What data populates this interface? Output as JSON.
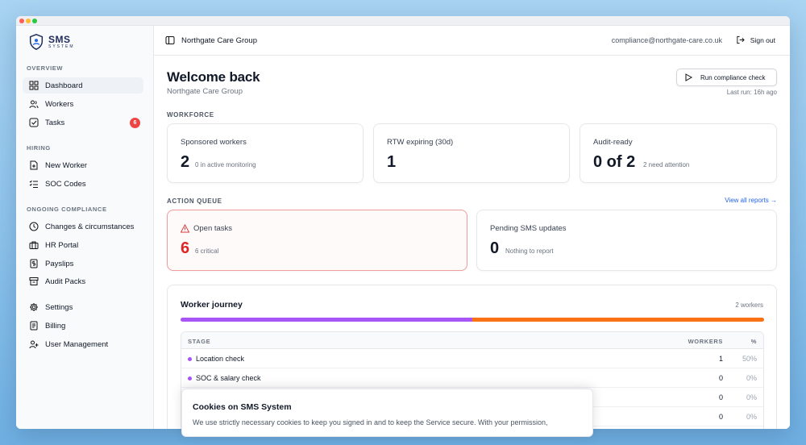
{
  "app": {
    "logo_main": "SMS",
    "logo_sub": "SYSTEM"
  },
  "sidebar": {
    "sections": [
      "OVERVIEW",
      "HIRING",
      "ONGOING COMPLIANCE"
    ],
    "items": [
      {
        "label": "Dashboard",
        "icon": "dashboard-icon",
        "active": true
      },
      {
        "label": "Workers",
        "icon": "users-icon"
      },
      {
        "label": "Tasks",
        "icon": "checkbox-icon",
        "badge": "6"
      },
      {
        "label": "New Worker",
        "icon": "file-plus-icon"
      },
      {
        "label": "SOC Codes",
        "icon": "list-check-icon"
      },
      {
        "label": "Changes & circumstances",
        "icon": "clock-icon"
      },
      {
        "label": "HR Portal",
        "icon": "briefcase-icon"
      },
      {
        "label": "Payslips",
        "icon": "receipt-icon"
      },
      {
        "label": "Audit Packs",
        "icon": "archive-icon"
      },
      {
        "label": "Settings",
        "icon": "gear-icon"
      },
      {
        "label": "Billing",
        "icon": "invoice-icon"
      },
      {
        "label": "User Management",
        "icon": "user-management-icon"
      }
    ]
  },
  "topbar": {
    "org": "Northgate Care Group",
    "email": "compliance@northgate-care.co.uk",
    "signout": "Sign out"
  },
  "header": {
    "title": "Welcome back",
    "subtitle": "Northgate Care Group",
    "run_button": "Run compliance check",
    "last_run": "Last run: 16h ago"
  },
  "workforce": {
    "label": "WORKFORCE",
    "cards": [
      {
        "title": "Sponsored workers",
        "value": "2",
        "note": "0 in active monitoring"
      },
      {
        "title": "RTW expiring (30d)",
        "value": "1",
        "note": ""
      },
      {
        "title": "Audit-ready",
        "value": "0 of 2",
        "note": "2 need attention"
      }
    ]
  },
  "action_queue": {
    "label": "ACTION QUEUE",
    "view_all": "View all reports →",
    "cards": [
      {
        "title": "Open tasks",
        "value": "6",
        "note": "6 critical"
      },
      {
        "title": "Pending SMS updates",
        "value": "0",
        "note": "Nothing to report"
      }
    ]
  },
  "journey": {
    "title": "Worker journey",
    "count": "2 workers",
    "progress": [
      {
        "fraction": 0.5,
        "color": "#a855f7"
      },
      {
        "fraction": 0.5,
        "color": "#f97316"
      }
    ],
    "columns": [
      "STAGE",
      "WORKERS",
      "%"
    ],
    "rows": [
      {
        "stage": "Location check",
        "workers": "1",
        "pct": "50%",
        "color": "#a855f7"
      },
      {
        "stage": "SOC & salary check",
        "workers": "0",
        "pct": "0%",
        "color": "#a855f7"
      },
      {
        "stage": "",
        "workers": "0",
        "pct": "0%",
        "color": "#a855f7"
      },
      {
        "stage": "",
        "workers": "0",
        "pct": "0%",
        "color": "#14b8a6"
      }
    ]
  },
  "cookie": {
    "title": "Cookies on SMS System",
    "text": "We use strictly necessary cookies to keep you signed in and to keep the Service secure. With your permission,"
  }
}
